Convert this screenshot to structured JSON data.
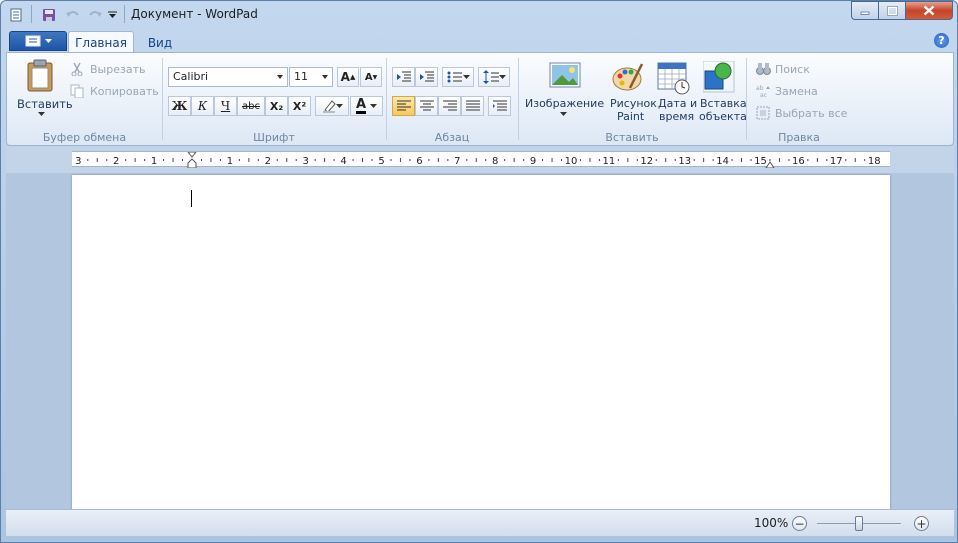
{
  "window": {
    "title": "Документ - WordPad"
  },
  "quick_access": [
    "wordpad-app-icon",
    "save-icon",
    "undo-icon",
    "redo-icon",
    "customize-arrow-icon"
  ],
  "tabs": {
    "home": "Главная",
    "view": "Вид"
  },
  "clipboard": {
    "paste": "Вставить",
    "cut": "Вырезать",
    "copy": "Копировать",
    "group": "Буфер обмена"
  },
  "font": {
    "name": "Calibri",
    "size": "11",
    "group": "Шрифт",
    "bold": "Ж",
    "italic": "К",
    "underline": "Ч",
    "strike": "abc",
    "sub": "X₂",
    "sup": "X²",
    "grow": "A",
    "shrink": "A",
    "color_letter": "A"
  },
  "paragraph": {
    "group": "Абзац"
  },
  "insert": {
    "image": "Изображение",
    "paint_1": "Рисунок",
    "paint_2": "Paint",
    "date_1": "Дата и",
    "date_2": "время",
    "object_1": "Вставка",
    "object_2": "объекта",
    "group": "Вставить"
  },
  "editing": {
    "find": "Поиск",
    "replace": "Замена",
    "select_all": "Выбрать все",
    "group": "Правка"
  },
  "ruler": {
    "labels": [
      "3",
      "2",
      "1",
      "1",
      "2",
      "3",
      "4",
      "5",
      "6",
      "7",
      "8",
      "9",
      "10",
      "11",
      "12",
      "13",
      "14",
      "15",
      "16",
      "17",
      "18"
    ]
  },
  "status": {
    "zoom": "100%",
    "zoom_out": "−",
    "zoom_in": "+",
    "zoom_level": 0.5
  },
  "colors": {
    "accent": "#1e55a6",
    "ribbon_bg": "#e6eef8",
    "close_red": "#c4452b"
  }
}
